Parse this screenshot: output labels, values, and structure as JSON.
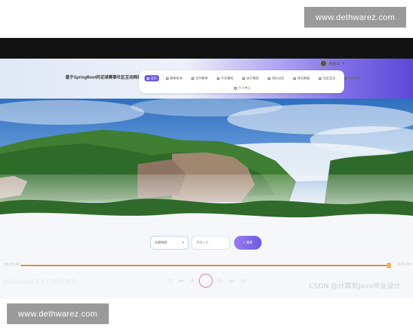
{
  "watermark": {
    "top_text": "www.dethwarez.com",
    "bottom_text": "www.dethwarez.com"
  },
  "site": {
    "title": "基于SpringBoot的足球赛事社区互动网站",
    "user_label": "欢迎11",
    "nav": [
      "首页",
      "赛事新闻",
      "实时赛事",
      "今日赛程",
      "关于赛程",
      "球队动态",
      "球员数据",
      "社区互动",
      "球库管理"
    ],
    "nav_second_row": "个人中心",
    "search": {
      "select_label": "标题搜索",
      "input_placeholder": "请输入名",
      "button_label": "搜索"
    }
  },
  "player": {
    "time_current": "00:07:20",
    "time_total": "0:00:00",
    "progress_fraction": 0.995,
    "capture_label": "EVCapture4.2.3.170软件录制",
    "controls": [
      "shuffle-icon",
      "prev-icon",
      "rewind-icon",
      "play-icon",
      "forward-icon",
      "next-icon",
      "loop-icon"
    ]
  },
  "attribution": "CSDN @计算机Java毕业设计",
  "colors": {
    "accent": "#6a57e0",
    "progress": "#e38b1d",
    "play_ring": "#e07b8a",
    "watermark_bg": "#9a9a9a"
  }
}
